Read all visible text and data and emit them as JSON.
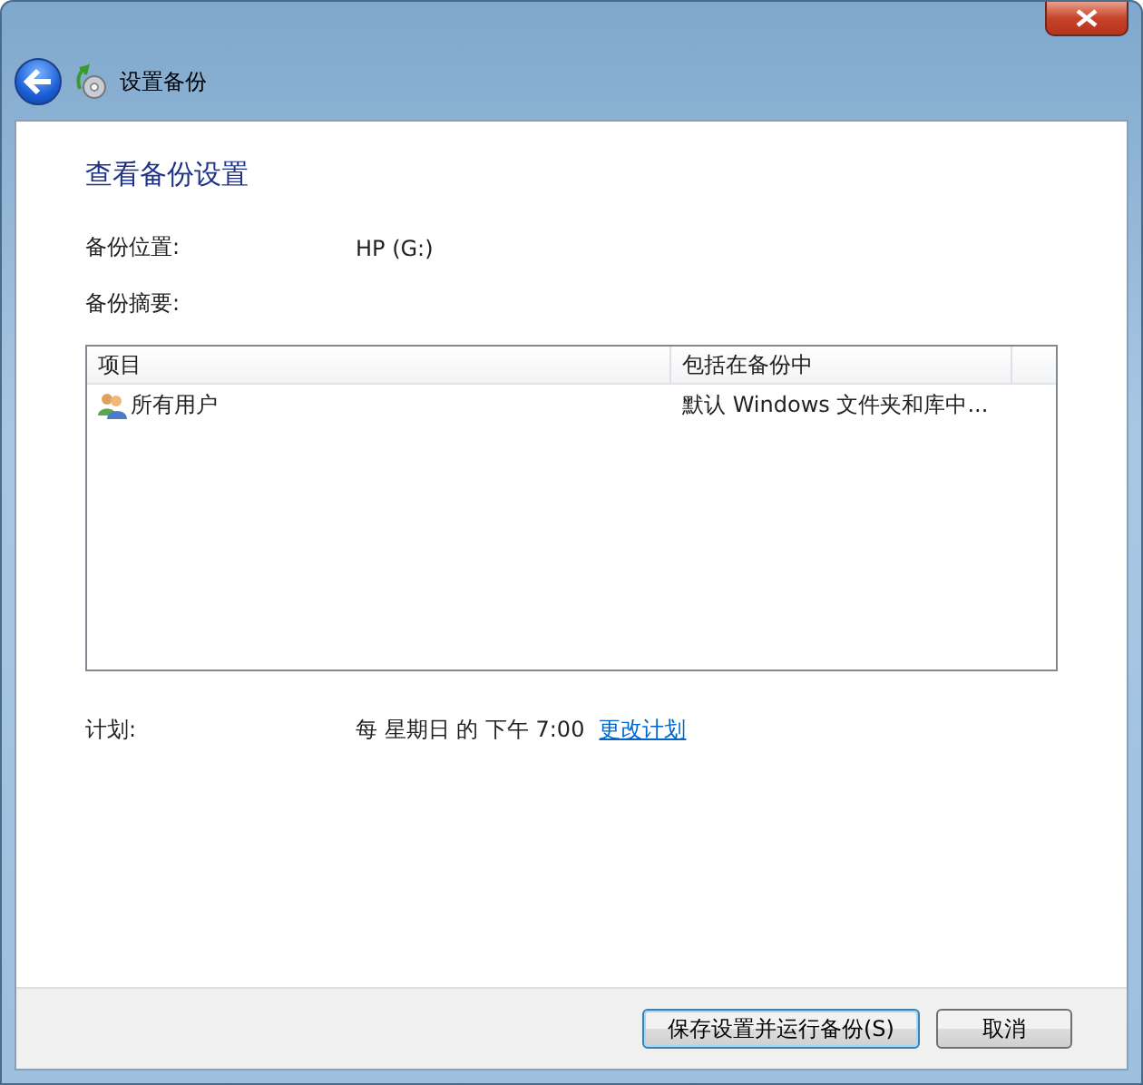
{
  "window": {
    "title": "设置备份"
  },
  "heading": "查看备份设置",
  "location": {
    "label": "备份位置:",
    "value": "HP (G:)"
  },
  "summary": {
    "label": "备份摘要:"
  },
  "table": {
    "columns": [
      "项目",
      "包括在备份中"
    ],
    "rows": [
      {
        "item": "所有用户",
        "included": "默认 Windows 文件夹和库中..."
      }
    ]
  },
  "schedule": {
    "label": "计划:",
    "value": "每 星期日 的 下午 7:00",
    "link": "更改计划"
  },
  "buttons": [
    {
      "label": "保存设置并运行备份(S)",
      "default": true
    },
    {
      "label": "取消",
      "default": false
    }
  ]
}
